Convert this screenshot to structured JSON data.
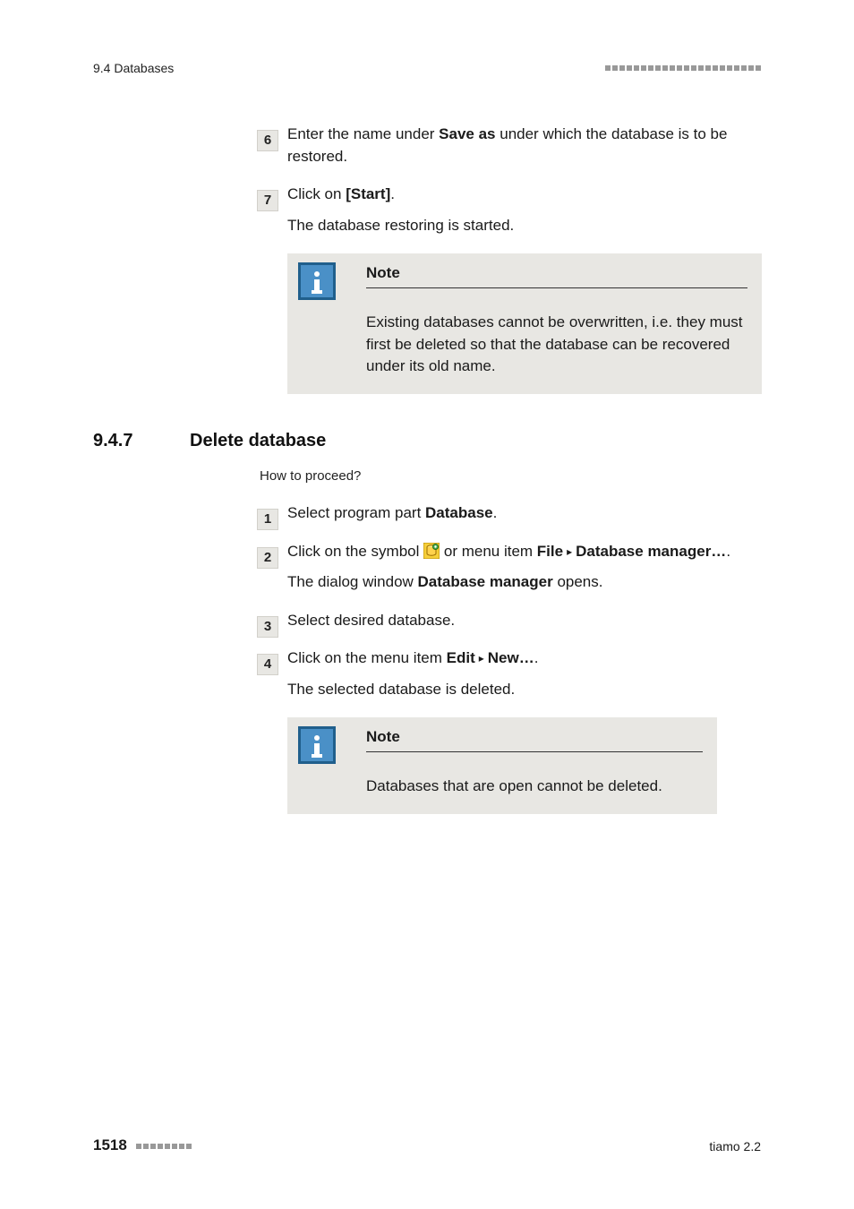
{
  "header": {
    "section_label": "9.4 Databases"
  },
  "restore_tail": {
    "step6": {
      "num": "6",
      "pre": "Enter the name under ",
      "bold": "Save as",
      "post": " under which the database is to be restored."
    },
    "step7": {
      "num": "7",
      "pre": "Click on ",
      "bold": "[Start]",
      "post": ".",
      "sub": "The database restoring is started."
    },
    "note": {
      "title": "Note",
      "body": "Existing databases cannot be overwritten, i.e. they must first be deleted so that the database can be recovered under its old name."
    }
  },
  "section_delete": {
    "number": "9.4.7",
    "title": "Delete database",
    "howto": "How to proceed?",
    "step1": {
      "num": "1",
      "pre": "Select program part ",
      "bold": "Database",
      "post": "."
    },
    "step2": {
      "num": "2",
      "pre": "Click on the symbol ",
      "mid": " or menu item ",
      "menu_a": "File",
      "menu_b": "Database manager…",
      "post": ".",
      "sub_pre": "The dialog window ",
      "sub_bold": "Database manager",
      "sub_post": " opens."
    },
    "step3": {
      "num": "3",
      "line": "Select desired database."
    },
    "step4": {
      "num": "4",
      "pre": "Click on the menu item ",
      "menu_a": "Edit",
      "menu_b": "New…",
      "post": ".",
      "sub": "The selected database is deleted."
    },
    "note": {
      "title": "Note",
      "body": "Databases that are open cannot be deleted."
    }
  },
  "footer": {
    "page": "1518",
    "product": "tiamo 2.2"
  }
}
